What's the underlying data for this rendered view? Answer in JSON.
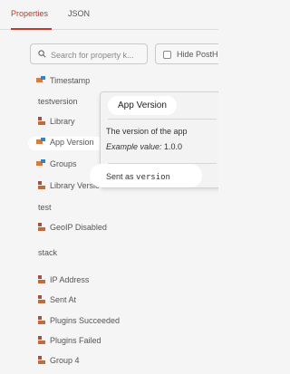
{
  "tabs": [
    {
      "label": "Properties",
      "active": true
    },
    {
      "label": "JSON",
      "active": false
    }
  ],
  "search": {
    "placeholder": "Search for property k..."
  },
  "hide_button": {
    "label": "Hide PostH"
  },
  "properties": [
    {
      "label": "Timestamp",
      "icon": "posthog-logo-icon"
    },
    {
      "label": "testversion",
      "icon": null
    },
    {
      "label": "Library",
      "icon": "property-icon"
    },
    {
      "label": "App Version",
      "icon": "posthog-logo-icon"
    },
    {
      "label": "Groups",
      "icon": "posthog-logo-icon"
    },
    {
      "label": "Library Versio",
      "icon": "property-icon"
    },
    {
      "label": "test",
      "icon": null
    },
    {
      "label": "GeoIP Disabled",
      "icon": "property-icon"
    },
    {
      "label": "stack",
      "icon": null
    },
    {
      "label": "IP Address",
      "icon": "property-icon"
    },
    {
      "label": "Sent At",
      "icon": "property-icon"
    },
    {
      "label": "Plugins Succeeded",
      "icon": "property-icon"
    },
    {
      "label": "Plugins Failed",
      "icon": "property-icon"
    },
    {
      "label": "Group 4",
      "icon": "property-icon"
    }
  ],
  "popover": {
    "title": "App Version",
    "description": "The version of the app",
    "example_label": "Example value:",
    "example_value": " 1.0.0",
    "sent_as_label": "Sent as ",
    "sent_as_value": "version"
  },
  "colors": {
    "accent": "#c0392b",
    "background": "#f5f5f5"
  }
}
